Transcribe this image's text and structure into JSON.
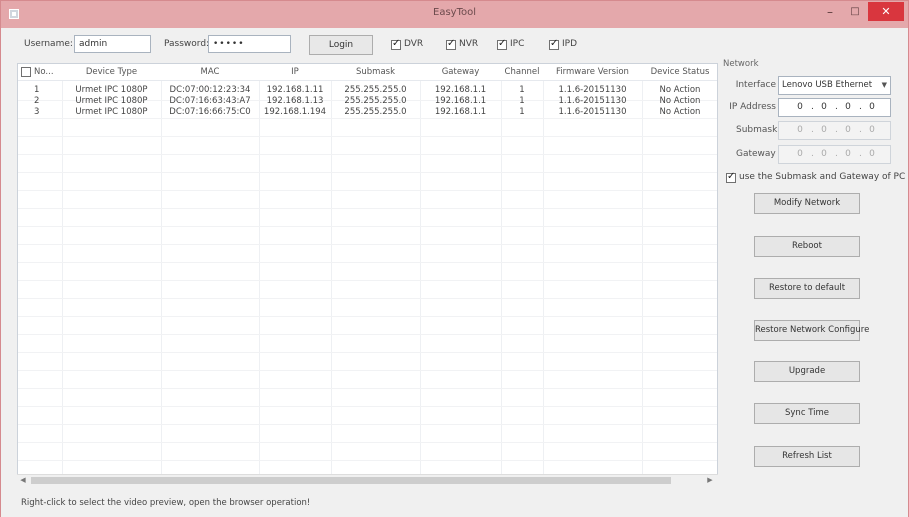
{
  "window": {
    "title": "EasyTool",
    "minimize": "–",
    "maximize": "□",
    "close": "✕"
  },
  "login": {
    "username_label": "Username:",
    "username_value": "admin",
    "password_label": "Password:",
    "password_value": "•••••",
    "login_label": "Login",
    "filters": [
      {
        "label": "DVR",
        "checked": true
      },
      {
        "label": "NVR",
        "checked": true
      },
      {
        "label": "IPC",
        "checked": true
      },
      {
        "label": "IPD",
        "checked": true
      }
    ]
  },
  "table": {
    "headers": [
      "No...",
      "Device Type",
      "MAC",
      "IP",
      "Submask",
      "Gateway",
      "Channel",
      "Firmware Version",
      "Device Status"
    ],
    "rows": [
      [
        "1",
        "Urmet IPC 1080P",
        "DC:07:00:12:23:34",
        "192.168.1.11",
        "255.255.255.0",
        "192.168.1.1",
        "1",
        "1.1.6-20151130",
        "No Action"
      ],
      [
        "2",
        "Urmet IPC 1080P",
        "DC:07:16:63:43:A7",
        "192.168.1.13",
        "255.255.255.0",
        "192.168.1.1",
        "1",
        "1.1.6-20151130",
        "No Action"
      ],
      [
        "3",
        "Urmet IPC 1080P",
        "DC:07:16:66:75:C0",
        "192.168.1.194",
        "255.255.255.0",
        "192.168.1.1",
        "1",
        "1.1.6-20151130",
        "No Action"
      ]
    ]
  },
  "network": {
    "title": "Network",
    "interface_label": "Interface",
    "interface_value": "Lenovo USB Ethernet",
    "ip_label": "IP Address",
    "ip_value": [
      "0",
      "0",
      "0",
      "0"
    ],
    "submask_label": "Submask",
    "submask_value": [
      "0",
      "0",
      "0",
      "0"
    ],
    "gateway_label": "Gateway",
    "gateway_value": [
      "0",
      "0",
      "0",
      "0"
    ],
    "use_pc_label": "use the Submask and Gateway of PC",
    "use_pc_checked": true,
    "modify_label": "Modify Network"
  },
  "actions": {
    "reboot": "Reboot",
    "restore_default": "Restore to default",
    "restore_network": "Restore Network Configure",
    "upgrade": "Upgrade",
    "sync_time": "Sync Time",
    "refresh": "Refresh List"
  },
  "status": "Right-click to select the video preview, open the browser operation!"
}
